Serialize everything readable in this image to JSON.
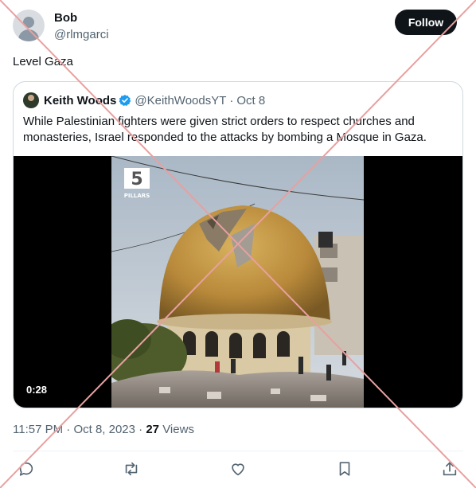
{
  "author": {
    "name": "Bob",
    "handle": "@rlmgarci"
  },
  "follow_label": "Follow",
  "tweet_text": "Level Gaza",
  "quoted": {
    "name": "Keith Woods",
    "handle": "@KeithWoodsYT",
    "separator": "·",
    "date": "Oct 8",
    "text": "While Palestinian fighters were given strict orders to respect churches and monasteries, Israel responded to the attacks by bombing a Mosque in Gaza.",
    "video": {
      "duration": "0:28",
      "watermark_number": "5",
      "watermark_text": "PILLARS"
    }
  },
  "meta": {
    "time": "11:57 PM",
    "separator1": " · ",
    "date": "Oct 8, 2023",
    "separator2": " · ",
    "views_count": "27",
    "views_label": " Views"
  },
  "colors": {
    "text": "#0f1419",
    "secondary": "#536471",
    "verified": "#1d9bf0",
    "overlay_cross": "#e8a0a0"
  },
  "icons": [
    "reply-icon",
    "retweet-icon",
    "like-icon",
    "bookmark-icon",
    "share-icon",
    "verified-badge-icon"
  ]
}
